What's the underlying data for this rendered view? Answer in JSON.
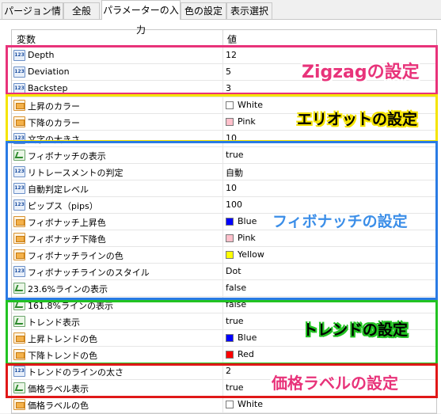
{
  "tabs": [
    "パージョン情報",
    "全般",
    "パラメーターの入力",
    "色の設定",
    "表示選択"
  ],
  "active_tab": 2,
  "table": {
    "col_variable": "変数",
    "col_value": "値",
    "rows": [
      {
        "icon": "num",
        "name": "Depth",
        "value": "12"
      },
      {
        "icon": "num",
        "name": "Deviation",
        "value": "5"
      },
      {
        "icon": "num",
        "name": "Backstep",
        "value": "3"
      },
      {
        "icon": "col",
        "name": "上昇のカラー",
        "value": "White",
        "swatch": "#ffffff"
      },
      {
        "icon": "col",
        "name": "下降のカラー",
        "value": "Pink",
        "swatch": "#ffc0cb"
      },
      {
        "icon": "num",
        "name": "文字の大きさ",
        "value": "10"
      },
      {
        "icon": "bool",
        "name": "フィボナッチの表示",
        "value": "true"
      },
      {
        "icon": "num",
        "name": "リトレースメントの判定",
        "value": "自動"
      },
      {
        "icon": "num",
        "name": "自動判定レベル",
        "value": "10"
      },
      {
        "icon": "num",
        "name": "ピップス（pips）",
        "value": "100"
      },
      {
        "icon": "col",
        "name": "フィボナッチ上昇色",
        "value": "Blue",
        "swatch": "#0000ff"
      },
      {
        "icon": "col",
        "name": "フィボナッチ下降色",
        "value": "Pink",
        "swatch": "#ffc0cb"
      },
      {
        "icon": "col",
        "name": "フィボナッチラインの色",
        "value": "Yellow",
        "swatch": "#ffff00"
      },
      {
        "icon": "num",
        "name": "フィボナッチラインのスタイル",
        "value": "Dot"
      },
      {
        "icon": "bool",
        "name": "23.6%ラインの表示",
        "value": "false"
      },
      {
        "icon": "bool",
        "name": "161.8%ラインの表示",
        "value": "false"
      },
      {
        "icon": "bool",
        "name": "トレンド表示",
        "value": "true"
      },
      {
        "icon": "col",
        "name": "上昇トレンドの色",
        "value": "Blue",
        "swatch": "#0000ff"
      },
      {
        "icon": "col",
        "name": "下降トレンドの色",
        "value": "Red",
        "swatch": "#ff0000"
      },
      {
        "icon": "num",
        "name": "トレンドのラインの太さ",
        "value": "2"
      },
      {
        "icon": "bool",
        "name": "価格ラベル表示",
        "value": "true"
      },
      {
        "icon": "col",
        "name": "価格ラベルの色",
        "value": "White",
        "swatch": "#ffffff"
      }
    ]
  },
  "annotations": [
    {
      "text": "Zigzagの設定",
      "color": "#e8337a"
    },
    {
      "text": "エリオットの設定",
      "color": "#000000"
    },
    {
      "text": "フィボナッチの設定",
      "color": "#3b8ee8"
    },
    {
      "text": "トレンドの設定",
      "color": "#000000"
    },
    {
      "text": "価格ラベルの設定",
      "color": "#e8337a"
    }
  ],
  "box_colors": [
    "#e8337a",
    "#f5e400",
    "#2a7be4",
    "#22c322",
    "#e01818"
  ]
}
